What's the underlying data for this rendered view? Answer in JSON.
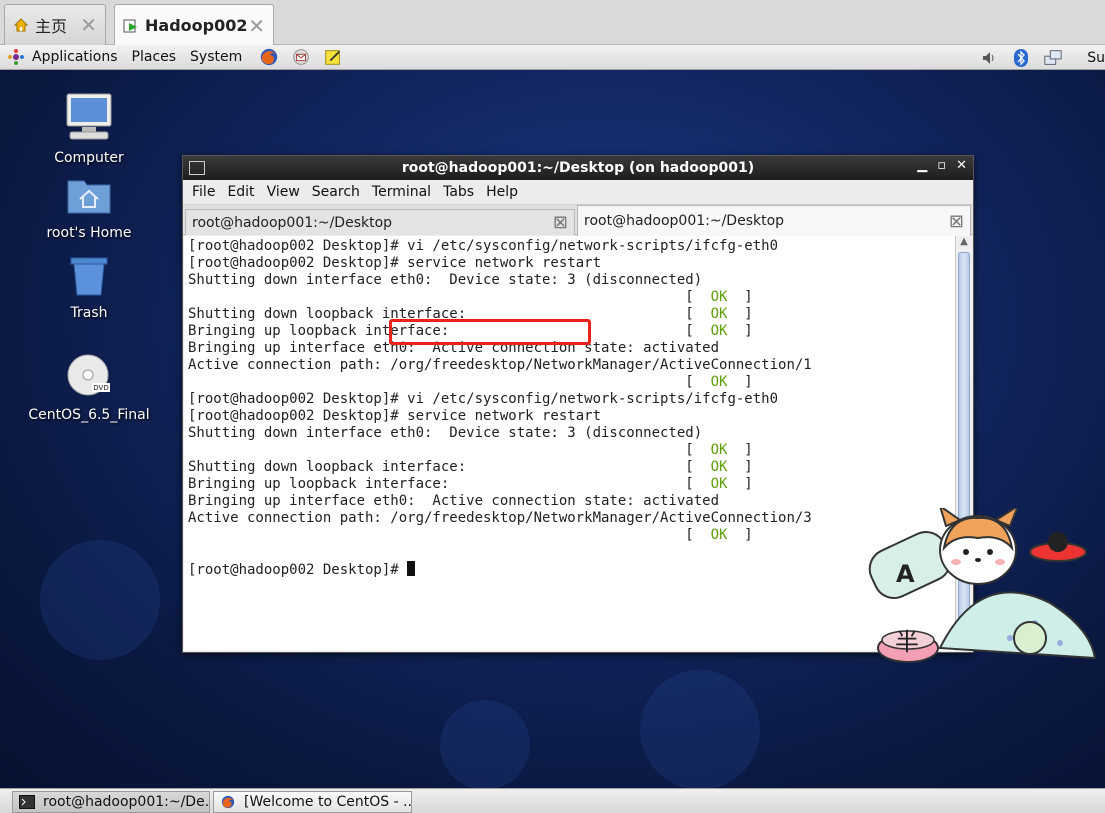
{
  "vm_tabs": [
    {
      "label": "主页",
      "icon": "home-icon"
    },
    {
      "label": "Hadoop002",
      "icon": "vm-running-icon"
    }
  ],
  "panel": {
    "menus": [
      "Applications",
      "Places",
      "System"
    ],
    "launchers": [
      "firefox-icon",
      "email-icon",
      "notes-icon"
    ],
    "tray": [
      "volume-icon",
      "bluetooth-icon",
      "network-icon"
    ],
    "clock": "Su"
  },
  "desktop_icons": [
    {
      "label": "Computer",
      "icon": "computer-icon"
    },
    {
      "label": "root's Home",
      "icon": "home-folder-icon"
    },
    {
      "label": "Trash",
      "icon": "trash-icon"
    },
    {
      "label": "CentOS_6.5_Final",
      "icon": "dvd-icon",
      "badge": "DVD"
    }
  ],
  "terminal": {
    "title": "root@hadoop001:~/Desktop (on hadoop001)",
    "menus": [
      "File",
      "Edit",
      "View",
      "Search",
      "Terminal",
      "Tabs",
      "Help"
    ],
    "tabs": [
      {
        "label": "root@hadoop001:~/Desktop",
        "active": false
      },
      {
        "label": "root@hadoop001:~/Desktop",
        "active": true
      }
    ],
    "lines": [
      {
        "text": "[root@hadoop002 Desktop]# vi /etc/sysconfig/network-scripts/ifcfg-eth0",
        "ok": ""
      },
      {
        "text": "[root@hadoop002 Desktop]# service network restart",
        "ok": ""
      },
      {
        "text": "Shutting down interface eth0:  Device state: 3 (disconnected)",
        "ok": ""
      },
      {
        "text": "                                                           [  ",
        "ok": "OK"
      },
      {
        "text": "Shutting down loopback interface:                          [  ",
        "ok": "OK"
      },
      {
        "text": "Bringing up loopback interface:                            [  ",
        "ok": "OK"
      },
      {
        "text": "Bringing up interface eth0:  Active connection state: activated",
        "ok": ""
      },
      {
        "text": "Active connection path: /org/freedesktop/NetworkManager/ActiveConnection/1",
        "ok": ""
      },
      {
        "text": "                                                           [  ",
        "ok": "OK"
      },
      {
        "text": "[root@hadoop002 Desktop]# vi /etc/sysconfig/network-scripts/ifcfg-eth0",
        "ok": ""
      },
      {
        "text": "[root@hadoop002 Desktop]# service network restart",
        "ok": ""
      },
      {
        "text": "Shutting down interface eth0:  Device state: 3 (disconnected)",
        "ok": ""
      },
      {
        "text": "                                                           [  ",
        "ok": "OK"
      },
      {
        "text": "Shutting down loopback interface:                          [  ",
        "ok": "OK"
      },
      {
        "text": "Bringing up loopback interface:                            [  ",
        "ok": "OK"
      },
      {
        "text": "Bringing up interface eth0:  Active connection state: activated",
        "ok": ""
      },
      {
        "text": "Active connection path: /org/freedesktop/NetworkManager/ActiveConnection/3",
        "ok": ""
      },
      {
        "text": "                                                           [  ",
        "ok": "OK"
      },
      {
        "text": "",
        "ok": ""
      },
      {
        "text": "[root@hadoop002 Desktop]# ",
        "ok": ""
      }
    ],
    "ok_suffix": "  ]",
    "highlight_color": "#e8231a"
  },
  "sticker": {
    "letter": "A",
    "bowl_char": "半"
  },
  "taskbar": [
    {
      "label": "root@hadoop001:~/De...",
      "icon": "terminal-icon"
    },
    {
      "label": "[Welcome to CentOS - ...",
      "icon": "firefox-icon"
    }
  ]
}
